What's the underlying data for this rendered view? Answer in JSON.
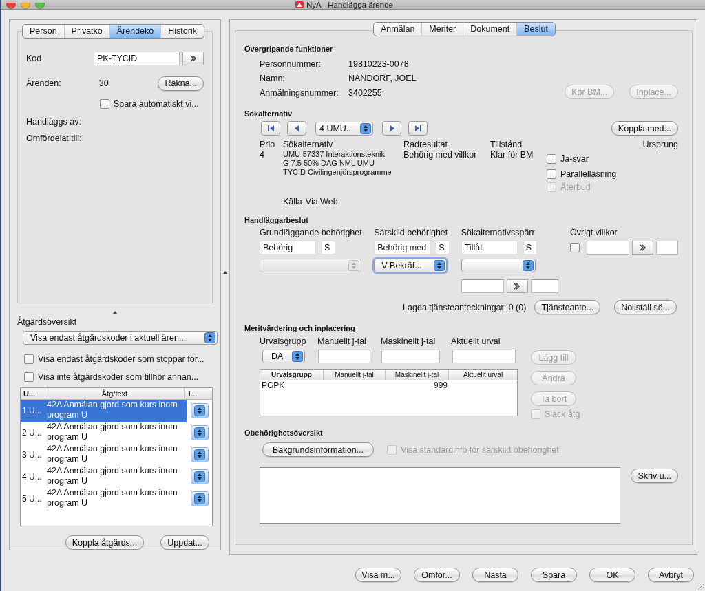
{
  "window": {
    "title": "NyA - Handlägga ärende"
  },
  "left_tabs": [
    {
      "label": "Person",
      "selected": false
    },
    {
      "label": "Privatkö",
      "selected": false
    },
    {
      "label": "Ärendekö",
      "selected": true
    },
    {
      "label": "Historik",
      "selected": false
    }
  ],
  "queue": {
    "code_label": "Kod",
    "code_value": "PK-TYCID",
    "cases_label": "Ärenden:",
    "cases_value": "30",
    "count_button": "Räkna...",
    "autosave": {
      "label": "Spara automatiskt vi...",
      "checked": false
    },
    "handled_by_label": "Handläggs av:",
    "reassigned_label": "Omfördelat till:"
  },
  "actions": {
    "title": "Åtgärdsöversikt",
    "filter_select": "Visa endast åtgärdskoder i aktuell ären...",
    "checkboxes": [
      {
        "label": "Visa endast åtgärdskoder som stoppar för...",
        "checked": false
      },
      {
        "label": "Visa inte åtgärdskoder som tillhör annan...",
        "checked": false
      }
    ],
    "columns": [
      "U...",
      "Åtg/text",
      "T..."
    ],
    "rows": [
      {
        "column_1": "1 U...",
        "text": "42A Anmälan gjord som kurs inom program U",
        "selected": true
      },
      {
        "column_1": "2 U...",
        "text": "42A Anmälan gjord som kurs inom program U",
        "selected": false
      },
      {
        "column_1": "3 U...",
        "text": "42A Anmälan gjord som kurs inom program U",
        "selected": false
      },
      {
        "column_1": "4 U...",
        "text": "42A Anmälan gjord som kurs inom program U",
        "selected": false
      },
      {
        "column_1": "5 U...",
        "text": "42A Anmälan gjord som kurs inom program U",
        "selected": false
      }
    ],
    "buttons": [
      "Koppla åtgärds...",
      "Uppdat..."
    ]
  },
  "right_tabs": [
    {
      "label": "Anmälan",
      "selected": false
    },
    {
      "label": "Meriter",
      "selected": false
    },
    {
      "label": "Dokument",
      "selected": false
    },
    {
      "label": "Beslut",
      "selected": true
    }
  ],
  "overview": {
    "title": "Övergripande funktioner",
    "fields": [
      {
        "label": "Personnummer:",
        "value": "19810223-0078"
      },
      {
        "label": "Namn:",
        "value": "NANDORF, JOEL"
      },
      {
        "label": "Anmälningsnummer:",
        "value": "3402255"
      }
    ],
    "buttons": [
      {
        "label": "Kör BM...",
        "disabled": true
      },
      {
        "label": "Inplace...",
        "disabled": true
      }
    ]
  },
  "search_alternatives": {
    "title": "Sökalternativ",
    "selector": "4 UMU...",
    "link_button": "Koppla med...",
    "columns": [
      "Prio",
      "Sökalternativ",
      "Radresultat",
      "Tillstånd",
      "Ursprung"
    ],
    "prio": "4",
    "alternative_lines": [
      "UMU-57337   Interaktionsteknik",
      "G 7.5 50% DAG NML UMU",
      "TYCID Civilingenjörsprogramme"
    ],
    "row_result": "Behörig med villkor",
    "state": "Klar för BM",
    "checkboxes": [
      {
        "label": "Ja-svar",
        "checked": false,
        "disabled": false
      },
      {
        "label": "Parallelläsning",
        "checked": false,
        "disabled": false
      },
      {
        "label": "Återbud",
        "checked": false,
        "disabled": true
      }
    ],
    "source_label": "Källa",
    "source_value": "Via Web"
  },
  "decision": {
    "title": "Handläggarbeslut",
    "columns": [
      {
        "label": "Grundläggande behörighet",
        "value": "Behörig",
        "code": "S",
        "select_disabled": true
      },
      {
        "label": "Särskild behörighet",
        "value": "Behörig med",
        "code": "S",
        "select": "V-Bekräf...",
        "select_disabled": false
      },
      {
        "label": "Sökalternativsspärr",
        "value": "Tillåt",
        "code": "S",
        "select_disabled": false
      }
    ],
    "other_label": "Övrigt villkor",
    "other_checked": false,
    "notes_label": "Lagda tjänsteanteckningar: 0 (0)",
    "buttons": [
      "Tjänsteante...",
      "Nollställ sö..."
    ]
  },
  "merit": {
    "title": "Meritvärdering och inplacering",
    "field_labels": [
      "Urvalsgrupp",
      "Manuellt j-tal",
      "Maskinellt j-tal",
      "Aktuellt urval"
    ],
    "group_select": "DA",
    "columns": [
      "Urvalsgrupp",
      "Manuellt j-tal",
      "Maskinellt j-tal",
      "Aktuellt urval"
    ],
    "rows": [
      {
        "urvalsgrupp": "PGPK",
        "maskinellt_j_tal": "999"
      }
    ],
    "buttons": [
      {
        "label": "Lägg till",
        "disabled": true
      },
      {
        "label": "Ändra",
        "disabled": true
      },
      {
        "label": "Ta bort",
        "disabled": true
      }
    ],
    "hide_checkbox": {
      "label": "Släck åtg",
      "checked": false,
      "disabled": true
    }
  },
  "ineligibility": {
    "title": "Obehörighetsöversikt",
    "background_button": "Bakgrundsinformation...",
    "standard_checkbox": {
      "label": "Visa standardinfo för särskild obehörighet",
      "checked": false,
      "disabled": true
    },
    "print_button": "Skriv u..."
  },
  "footer_buttons": [
    "Visa m...",
    "Omför...",
    "Nästa",
    "Spara",
    "OK",
    "Avbryt"
  ]
}
